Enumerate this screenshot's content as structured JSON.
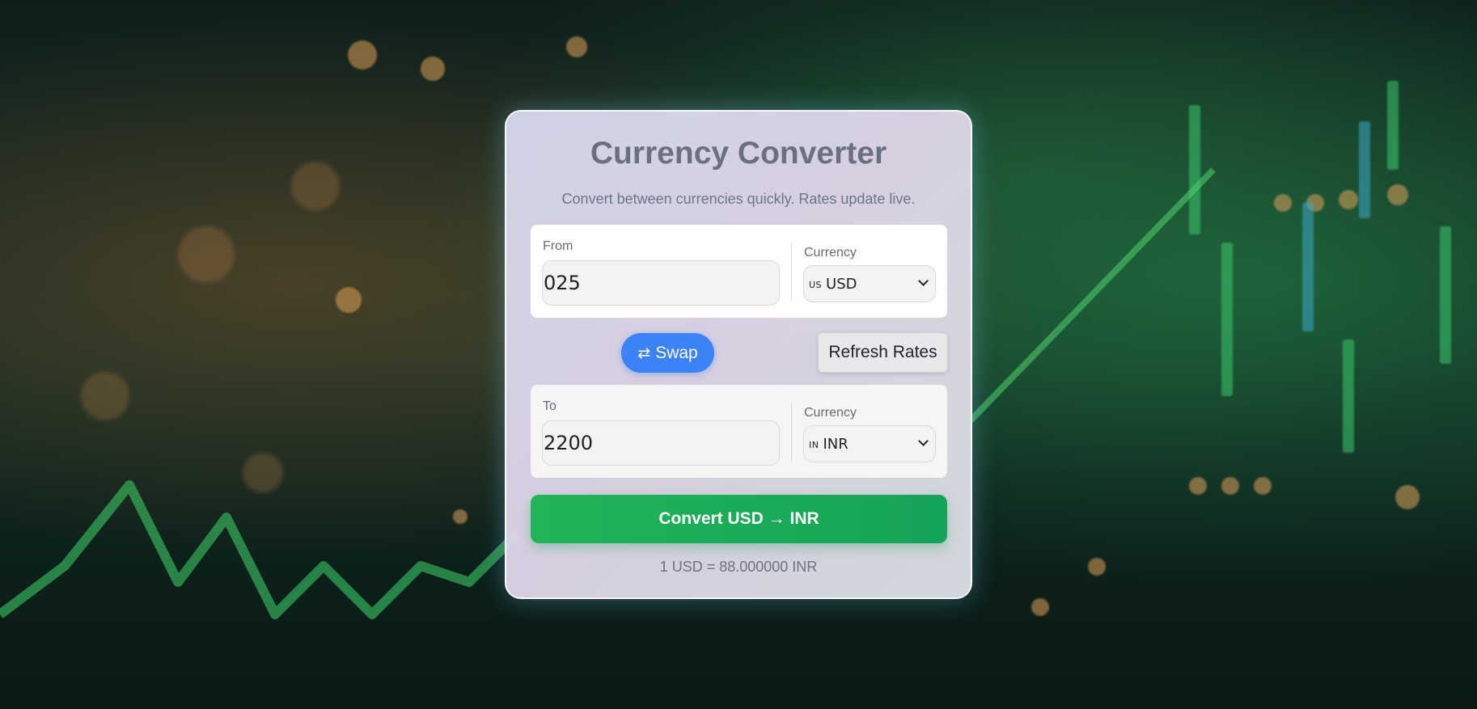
{
  "app": {
    "title": "Currency Converter",
    "subtitle": "Convert between currencies quickly. Rates update live."
  },
  "from": {
    "label": "From",
    "amount": "025",
    "currency_label": "Currency",
    "currency_flag": "US",
    "currency_code": "USD"
  },
  "actions": {
    "swap_label": "Swap",
    "swap_icon": "⇄",
    "refresh_label": "Refresh Rates"
  },
  "to": {
    "label": "To",
    "amount": "2200",
    "currency_label": "Currency",
    "currency_flag": "IN",
    "currency_code": "INR"
  },
  "convert": {
    "label": "Convert USD → INR"
  },
  "rate": {
    "text": "1 USD = 88.000000 INR"
  },
  "colors": {
    "swap_button": "#3b82f6",
    "convert_button": "#22b457",
    "title": "#6b7080"
  }
}
